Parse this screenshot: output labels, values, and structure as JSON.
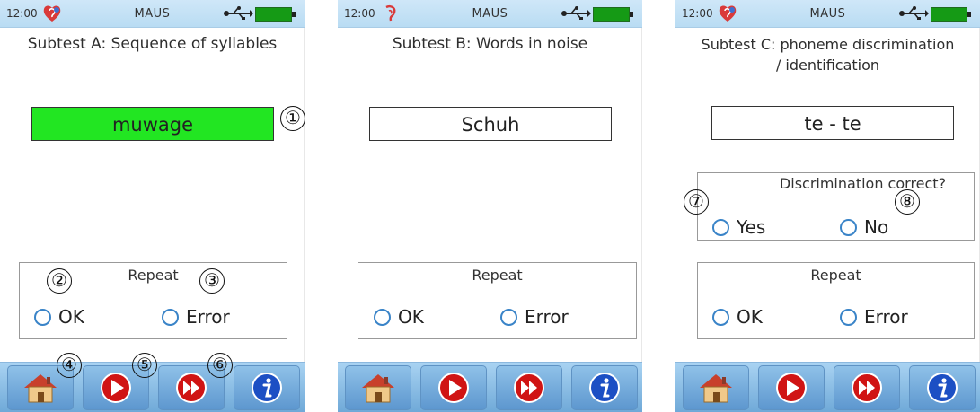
{
  "screens": [
    {
      "status": {
        "time": "12:00",
        "title": "MAUS"
      },
      "heading": "Subtest A: Sequence of syllables",
      "word": "muwage",
      "repeat": {
        "title": "Repeat",
        "ok": "OK",
        "error": "Error"
      },
      "callouts": {
        "word": "①",
        "ok": "②",
        "error": "③",
        "home": "④",
        "play": "⑤",
        "skip": "⑥"
      }
    },
    {
      "status": {
        "time": "12:00",
        "title": "MAUS"
      },
      "heading": "Subtest B: Words in noise",
      "word": "Schuh",
      "repeat": {
        "title": "Repeat",
        "ok": "OK",
        "error": "Error"
      }
    },
    {
      "status": {
        "time": "12:00",
        "title": "MAUS"
      },
      "heading_line1": "Subtest C: phoneme discrimination",
      "heading_line2": "/ identification",
      "word": "te - te",
      "discrimination": {
        "title": "Discrimination correct?",
        "yes": "Yes",
        "no": "No"
      },
      "repeat": {
        "title": "Repeat",
        "ok": "OK",
        "error": "Error"
      },
      "callouts": {
        "yes": "⑦",
        "no": "⑧"
      }
    }
  ],
  "colors": {
    "highlight": "#22e622",
    "statusbar": "#c5e2f6",
    "navbar": "#8cc1ea",
    "radio": "#3a84c8",
    "battery": "#159a15"
  },
  "icons": [
    "ear-logo-icon",
    "usb-icon",
    "battery-icon",
    "home-icon",
    "play-icon",
    "skip-forward-icon",
    "info-icon"
  ]
}
